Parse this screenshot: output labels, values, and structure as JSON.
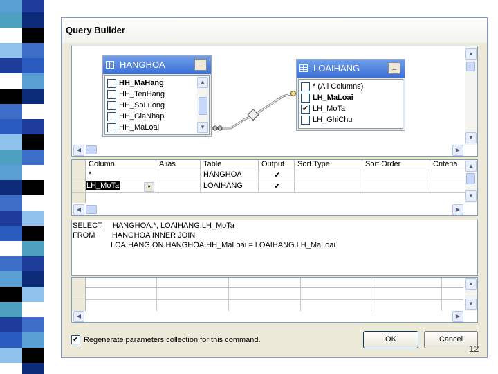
{
  "dialog": {
    "title": "Query Builder"
  },
  "diagram": {
    "table1": {
      "name": "HANGHOA",
      "columns": [
        {
          "label": "HH_MaHang",
          "checked": false,
          "bold": true
        },
        {
          "label": "HH_TenHang",
          "checked": false,
          "bold": false
        },
        {
          "label": "HH_SoLuong",
          "checked": false,
          "bold": false
        },
        {
          "label": "HH_GiaNhap",
          "checked": false,
          "bold": false
        },
        {
          "label": "HH_MaLoai",
          "checked": false,
          "bold": false
        }
      ]
    },
    "table2": {
      "name": "LOAIHANG",
      "columns": [
        {
          "label": "* (All Columns)",
          "checked": false,
          "bold": false
        },
        {
          "label": "LH_MaLoai",
          "checked": false,
          "bold": true
        },
        {
          "label": "LH_MoTa",
          "checked": true,
          "bold": false
        },
        {
          "label": "LH_GhiChu",
          "checked": false,
          "bold": false
        }
      ]
    }
  },
  "grid": {
    "headers": [
      "Column",
      "Alias",
      "Table",
      "Output",
      "Sort Type",
      "Sort Order",
      "Criteria"
    ],
    "rows": [
      {
        "column": "*",
        "alias": "",
        "table": "HANGHOA",
        "output": "✔",
        "sort_type": "",
        "sort_order": "",
        "criteria": ""
      },
      {
        "column": "LH_MoTa",
        "alias": "",
        "table": "LOAIHANG",
        "output": "✔",
        "sort_type": "",
        "sort_order": "",
        "criteria": ""
      }
    ]
  },
  "sql": {
    "lines": [
      "SELECT     HANGHOA.*, LOAIHANG.LH_MoTa",
      "FROM        HANGHOA INNER JOIN",
      "                  LOAIHANG ON HANGHOA.HH_MaLoai = LOAIHANG.LH_MaLoai"
    ]
  },
  "footer": {
    "regenerate_label": "Regenerate parameters collection for this command.",
    "regenerate_checked": true,
    "ok_label": "OK",
    "cancel_label": "Cancel"
  },
  "slide_number": "12",
  "colors": {
    "title_gradient_top": "#6f9fe8",
    "title_gradient_bottom": "#3a6fd8",
    "strip_blue": "#2a4fb0"
  }
}
